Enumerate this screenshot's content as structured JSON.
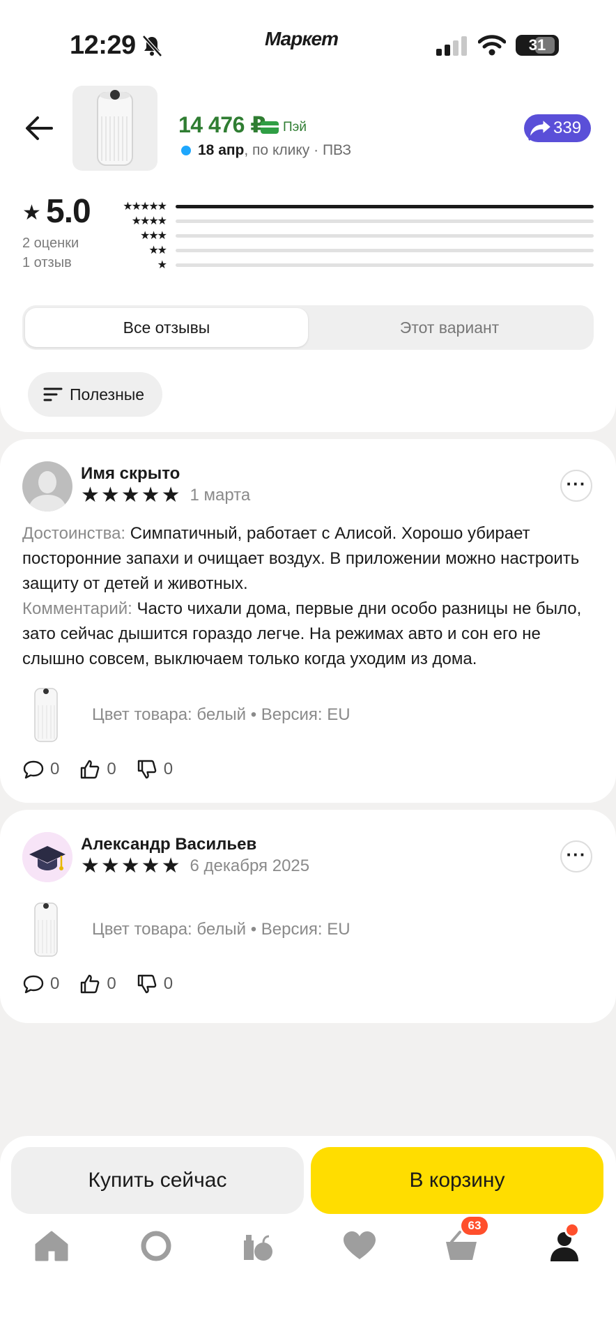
{
  "status_bar": {
    "time": "12:29",
    "app": "Маркет",
    "battery": "31"
  },
  "product": {
    "price": "14 476 ₽",
    "pay_label": "Пэй",
    "delivery_date": "18 апр",
    "delivery_rest": ", по клику · ПВЗ",
    "share_count": "339"
  },
  "rating": {
    "value": "5.0",
    "ratings_count": "2 оценки",
    "reviews_count": "1 отзыв",
    "distribution": [
      {
        "stars": "★★★★★",
        "fraction": 1.0
      },
      {
        "stars": "★★★★",
        "fraction": 0
      },
      {
        "stars": "★★★",
        "fraction": 0
      },
      {
        "stars": "★★",
        "fraction": 0
      },
      {
        "stars": "★",
        "fraction": 0
      }
    ]
  },
  "tabs": {
    "all": "Все отзывы",
    "variant": "Этот вариант"
  },
  "sort": {
    "label": "Полезные"
  },
  "reviews": [
    {
      "author": "Имя скрыто",
      "stars": "★★★★★",
      "date": "1 марта",
      "pros_label": "Достоинства:",
      "pros": " Симпатичный, работает с Алисой. Хорошо убирает посторонние запахи и очищает воздух. В приложении можно настроить защиту от детей и животных.",
      "comment_label": "Комментарий:",
      "comment": " Часто чихали дома, первые дни особо разницы не было, зато сейчас дышится гораздо легче. На режимах авто и сон его не слышно совсем, выключаем только когда уходим из дома.",
      "variant": "Цвет товара: белый • Версия: EU",
      "comments": "0",
      "likes": "0",
      "dislikes": "0"
    },
    {
      "author": "Александр Васильев",
      "stars": "★★★★★",
      "date": "6 декабря 2025",
      "variant": "Цвет товара: белый • Версия: EU",
      "comments": "0",
      "likes": "0",
      "dislikes": "0"
    }
  ],
  "actions": {
    "buy_now": "Купить сейчас",
    "add_to_cart": "В корзину"
  },
  "tabbar": {
    "cart_badge": "63"
  },
  "colors": {
    "accent_yellow": "#ffdd00",
    "price_green": "#2f7d32",
    "share_purple": "#5a4fd8",
    "badge_red": "#ff4f2c"
  }
}
